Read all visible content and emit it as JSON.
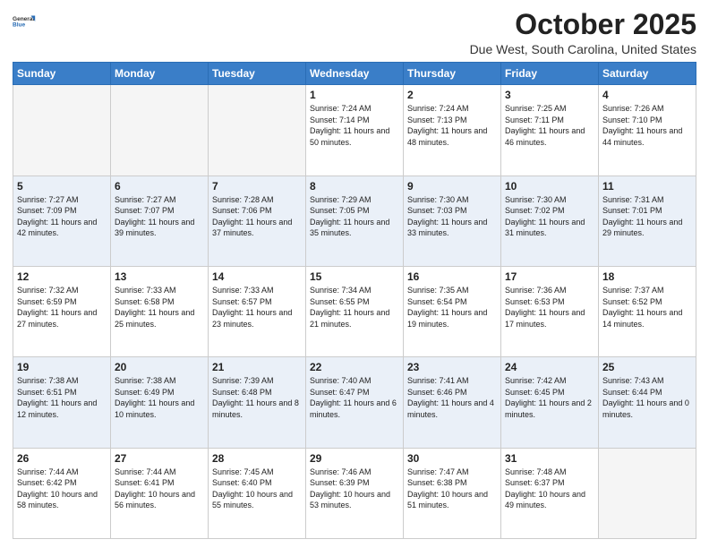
{
  "logo": {
    "line1": "General",
    "line2": "Blue"
  },
  "title": "October 2025",
  "location": "Due West, South Carolina, United States",
  "days_of_week": [
    "Sunday",
    "Monday",
    "Tuesday",
    "Wednesday",
    "Thursday",
    "Friday",
    "Saturday"
  ],
  "weeks": [
    [
      {
        "day": "",
        "info": ""
      },
      {
        "day": "",
        "info": ""
      },
      {
        "day": "",
        "info": ""
      },
      {
        "day": "1",
        "info": "Sunrise: 7:24 AM\nSunset: 7:14 PM\nDaylight: 11 hours\nand 50 minutes."
      },
      {
        "day": "2",
        "info": "Sunrise: 7:24 AM\nSunset: 7:13 PM\nDaylight: 11 hours\nand 48 minutes."
      },
      {
        "day": "3",
        "info": "Sunrise: 7:25 AM\nSunset: 7:11 PM\nDaylight: 11 hours\nand 46 minutes."
      },
      {
        "day": "4",
        "info": "Sunrise: 7:26 AM\nSunset: 7:10 PM\nDaylight: 11 hours\nand 44 minutes."
      }
    ],
    [
      {
        "day": "5",
        "info": "Sunrise: 7:27 AM\nSunset: 7:09 PM\nDaylight: 11 hours\nand 42 minutes."
      },
      {
        "day": "6",
        "info": "Sunrise: 7:27 AM\nSunset: 7:07 PM\nDaylight: 11 hours\nand 39 minutes."
      },
      {
        "day": "7",
        "info": "Sunrise: 7:28 AM\nSunset: 7:06 PM\nDaylight: 11 hours\nand 37 minutes."
      },
      {
        "day": "8",
        "info": "Sunrise: 7:29 AM\nSunset: 7:05 PM\nDaylight: 11 hours\nand 35 minutes."
      },
      {
        "day": "9",
        "info": "Sunrise: 7:30 AM\nSunset: 7:03 PM\nDaylight: 11 hours\nand 33 minutes."
      },
      {
        "day": "10",
        "info": "Sunrise: 7:30 AM\nSunset: 7:02 PM\nDaylight: 11 hours\nand 31 minutes."
      },
      {
        "day": "11",
        "info": "Sunrise: 7:31 AM\nSunset: 7:01 PM\nDaylight: 11 hours\nand 29 minutes."
      }
    ],
    [
      {
        "day": "12",
        "info": "Sunrise: 7:32 AM\nSunset: 6:59 PM\nDaylight: 11 hours\nand 27 minutes."
      },
      {
        "day": "13",
        "info": "Sunrise: 7:33 AM\nSunset: 6:58 PM\nDaylight: 11 hours\nand 25 minutes."
      },
      {
        "day": "14",
        "info": "Sunrise: 7:33 AM\nSunset: 6:57 PM\nDaylight: 11 hours\nand 23 minutes."
      },
      {
        "day": "15",
        "info": "Sunrise: 7:34 AM\nSunset: 6:55 PM\nDaylight: 11 hours\nand 21 minutes."
      },
      {
        "day": "16",
        "info": "Sunrise: 7:35 AM\nSunset: 6:54 PM\nDaylight: 11 hours\nand 19 minutes."
      },
      {
        "day": "17",
        "info": "Sunrise: 7:36 AM\nSunset: 6:53 PM\nDaylight: 11 hours\nand 17 minutes."
      },
      {
        "day": "18",
        "info": "Sunrise: 7:37 AM\nSunset: 6:52 PM\nDaylight: 11 hours\nand 14 minutes."
      }
    ],
    [
      {
        "day": "19",
        "info": "Sunrise: 7:38 AM\nSunset: 6:51 PM\nDaylight: 11 hours\nand 12 minutes."
      },
      {
        "day": "20",
        "info": "Sunrise: 7:38 AM\nSunset: 6:49 PM\nDaylight: 11 hours\nand 10 minutes."
      },
      {
        "day": "21",
        "info": "Sunrise: 7:39 AM\nSunset: 6:48 PM\nDaylight: 11 hours\nand 8 minutes."
      },
      {
        "day": "22",
        "info": "Sunrise: 7:40 AM\nSunset: 6:47 PM\nDaylight: 11 hours\nand 6 minutes."
      },
      {
        "day": "23",
        "info": "Sunrise: 7:41 AM\nSunset: 6:46 PM\nDaylight: 11 hours\nand 4 minutes."
      },
      {
        "day": "24",
        "info": "Sunrise: 7:42 AM\nSunset: 6:45 PM\nDaylight: 11 hours\nand 2 minutes."
      },
      {
        "day": "25",
        "info": "Sunrise: 7:43 AM\nSunset: 6:44 PM\nDaylight: 11 hours\nand 0 minutes."
      }
    ],
    [
      {
        "day": "26",
        "info": "Sunrise: 7:44 AM\nSunset: 6:42 PM\nDaylight: 10 hours\nand 58 minutes."
      },
      {
        "day": "27",
        "info": "Sunrise: 7:44 AM\nSunset: 6:41 PM\nDaylight: 10 hours\nand 56 minutes."
      },
      {
        "day": "28",
        "info": "Sunrise: 7:45 AM\nSunset: 6:40 PM\nDaylight: 10 hours\nand 55 minutes."
      },
      {
        "day": "29",
        "info": "Sunrise: 7:46 AM\nSunset: 6:39 PM\nDaylight: 10 hours\nand 53 minutes."
      },
      {
        "day": "30",
        "info": "Sunrise: 7:47 AM\nSunset: 6:38 PM\nDaylight: 10 hours\nand 51 minutes."
      },
      {
        "day": "31",
        "info": "Sunrise: 7:48 AM\nSunset: 6:37 PM\nDaylight: 10 hours\nand 49 minutes."
      },
      {
        "day": "",
        "info": ""
      }
    ]
  ]
}
